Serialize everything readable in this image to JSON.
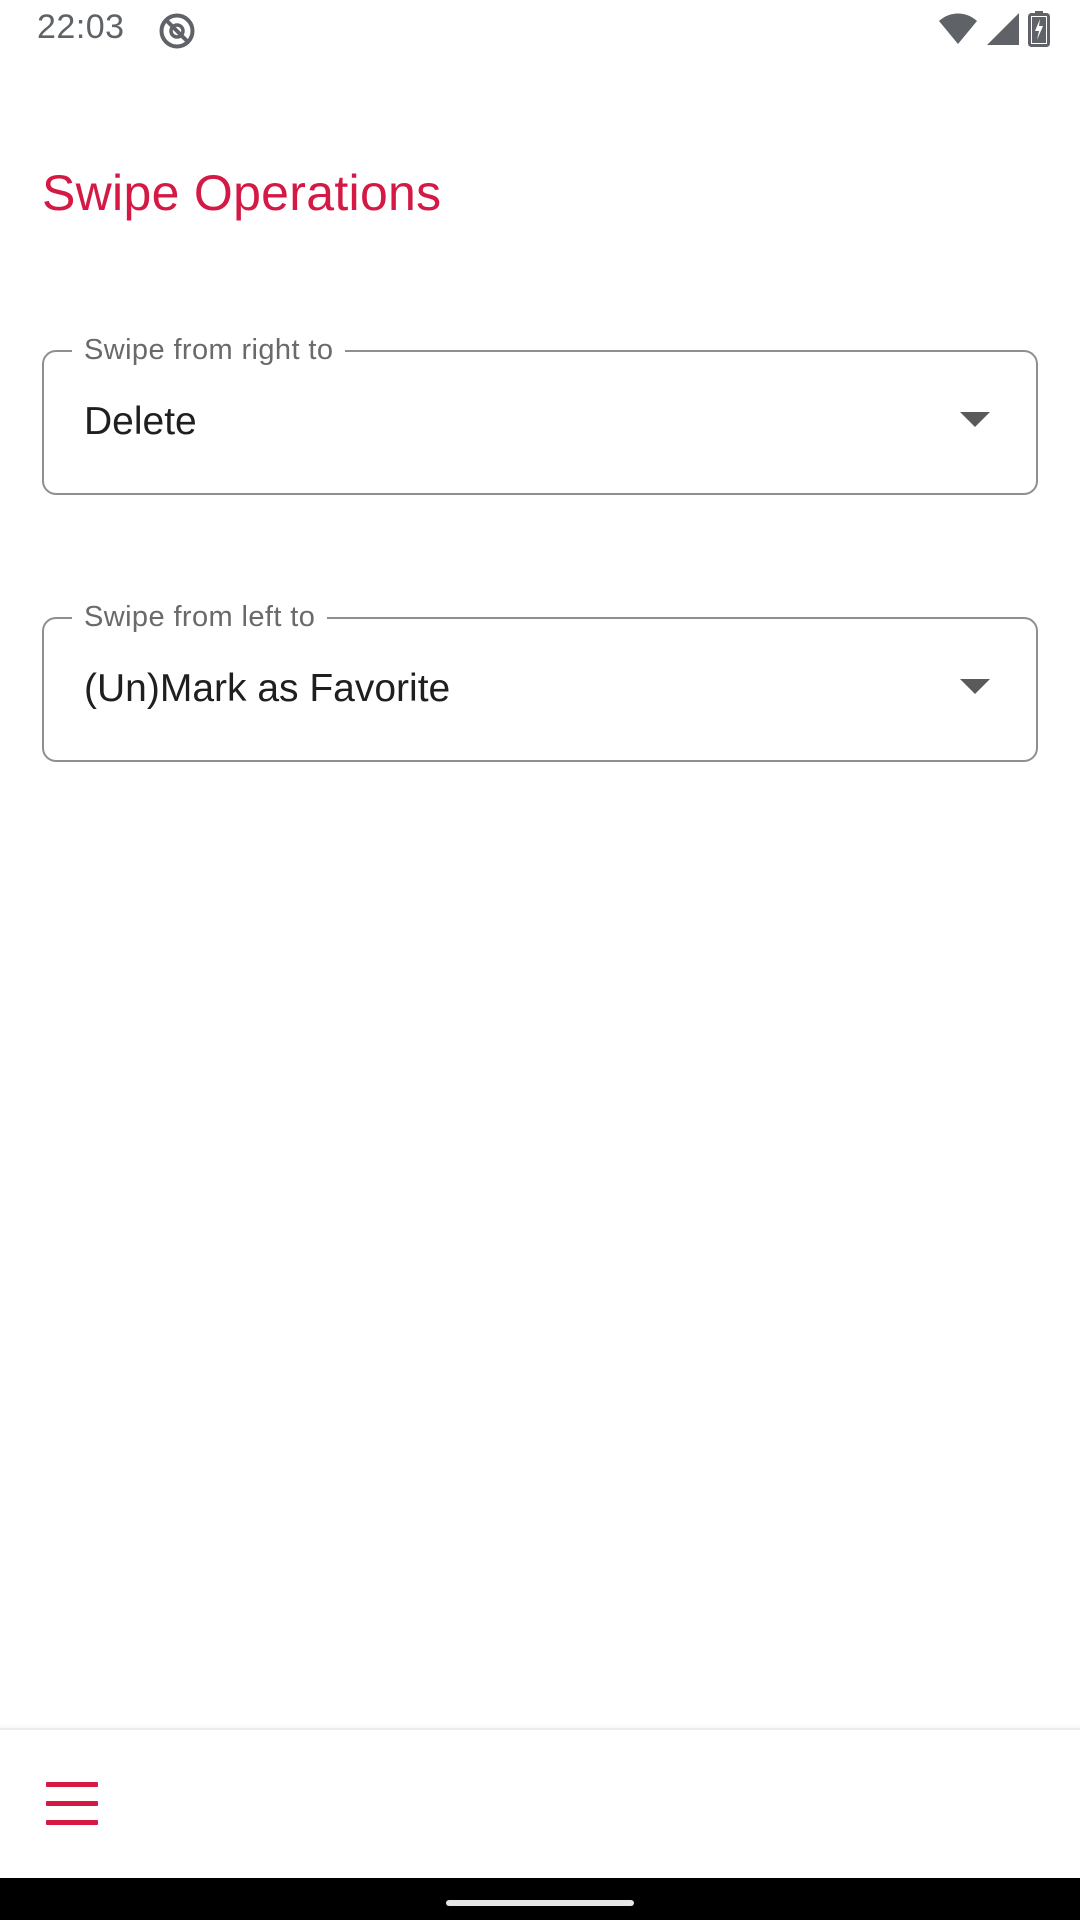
{
  "status_bar": {
    "time": "22:03",
    "left_icons": [
      "do-not-disturb-icon"
    ],
    "right_icons": [
      "wifi-icon",
      "cellular-signal-icon",
      "battery-charging-icon"
    ]
  },
  "page": {
    "title": "Swipe Operations"
  },
  "fields": [
    {
      "label": "Swipe from right to",
      "value": "Delete",
      "icon": "dropdown-arrow-icon"
    },
    {
      "label": "Swipe from left to",
      "value": "(Un)Mark as Favorite",
      "icon": "dropdown-arrow-icon"
    }
  ],
  "bottom_bar": {
    "menu_icon": "menu-icon"
  },
  "colors": {
    "accent": "#d41945",
    "outline": "#8f8f8f",
    "status_text": "#5f6368"
  }
}
